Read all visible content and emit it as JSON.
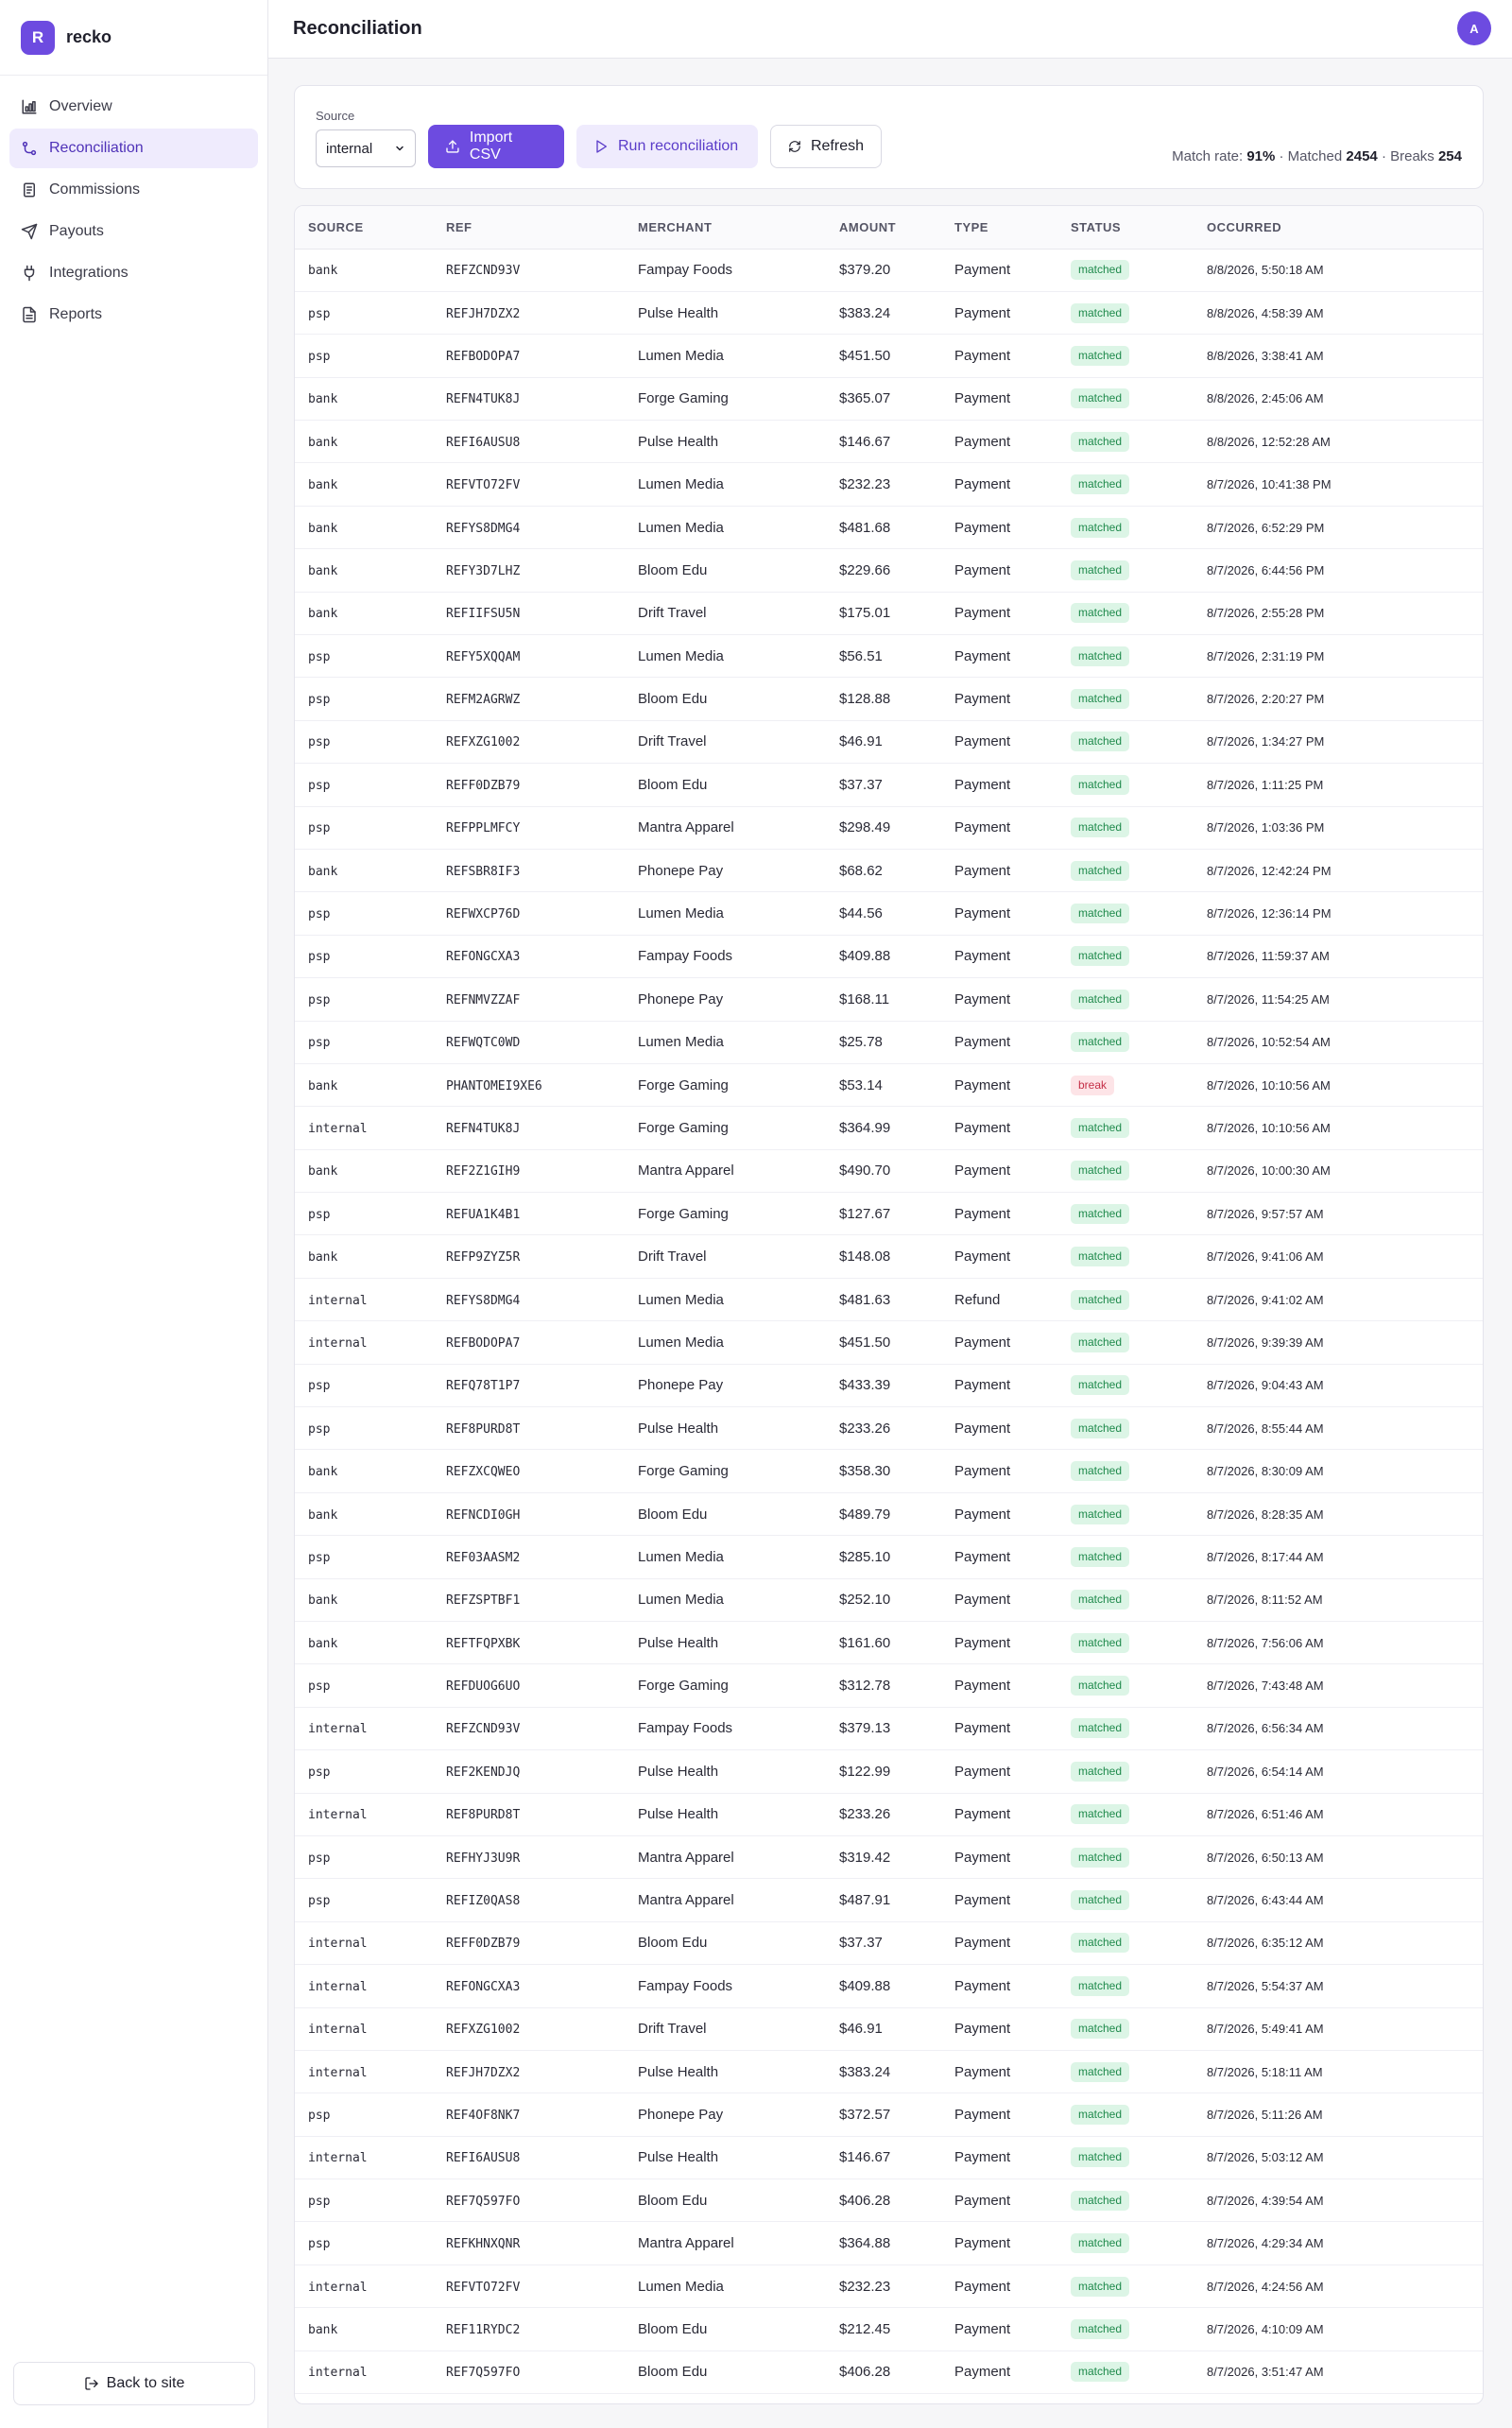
{
  "brand": {
    "logo_letter": "R",
    "name": "recko"
  },
  "nav": [
    {
      "label": "Overview",
      "icon": "bar-chart-icon",
      "active": false
    },
    {
      "label": "Reconciliation",
      "icon": "git-merge-icon",
      "active": true
    },
    {
      "label": "Commissions",
      "icon": "receipt-icon",
      "active": false
    },
    {
      "label": "Payouts",
      "icon": "send-icon",
      "active": false
    },
    {
      "label": "Integrations",
      "icon": "plug-icon",
      "active": false
    },
    {
      "label": "Reports",
      "icon": "file-text-icon",
      "active": false
    }
  ],
  "back_to_site": "Back to site",
  "header": {
    "title": "Reconciliation",
    "avatar": "A"
  },
  "controls": {
    "source_label": "Source",
    "source_value": "internal",
    "import_label": "Import CSV",
    "run_label": "Run reconciliation",
    "refresh_label": "Refresh"
  },
  "stats": {
    "match_rate_label": "Match rate:",
    "match_rate": "91%",
    "matched_label": "· Matched",
    "matched": "2454",
    "breaks_label": "· Breaks",
    "breaks": "254"
  },
  "colors": {
    "accent": "#6d4be0",
    "matched": "#1f8a4c",
    "break": "#c53048"
  },
  "table": {
    "columns": [
      "SOURCE",
      "REF",
      "MERCHANT",
      "AMOUNT",
      "TYPE",
      "STATUS",
      "OCCURRED"
    ],
    "rows": [
      [
        "bank",
        "REFZCND93V",
        "Fampay Foods",
        "$379.20",
        "Payment",
        "matched",
        "8/8/2026, 5:50:18 AM"
      ],
      [
        "psp",
        "REFJH7DZX2",
        "Pulse Health",
        "$383.24",
        "Payment",
        "matched",
        "8/8/2026, 4:58:39 AM"
      ],
      [
        "psp",
        "REFBODOPA7",
        "Lumen Media",
        "$451.50",
        "Payment",
        "matched",
        "8/8/2026, 3:38:41 AM"
      ],
      [
        "bank",
        "REFN4TUK8J",
        "Forge Gaming",
        "$365.07",
        "Payment",
        "matched",
        "8/8/2026, 2:45:06 AM"
      ],
      [
        "bank",
        "REFI6AUSU8",
        "Pulse Health",
        "$146.67",
        "Payment",
        "matched",
        "8/8/2026, 12:52:28 AM"
      ],
      [
        "bank",
        "REFVTO72FV",
        "Lumen Media",
        "$232.23",
        "Payment",
        "matched",
        "8/7/2026, 10:41:38 PM"
      ],
      [
        "bank",
        "REFYS8DMG4",
        "Lumen Media",
        "$481.68",
        "Payment",
        "matched",
        "8/7/2026, 6:52:29 PM"
      ],
      [
        "bank",
        "REFY3D7LHZ",
        "Bloom Edu",
        "$229.66",
        "Payment",
        "matched",
        "8/7/2026, 6:44:56 PM"
      ],
      [
        "bank",
        "REFIIFSU5N",
        "Drift Travel",
        "$175.01",
        "Payment",
        "matched",
        "8/7/2026, 2:55:28 PM"
      ],
      [
        "psp",
        "REFY5XQQAM",
        "Lumen Media",
        "$56.51",
        "Payment",
        "matched",
        "8/7/2026, 2:31:19 PM"
      ],
      [
        "psp",
        "REFM2AGRWZ",
        "Bloom Edu",
        "$128.88",
        "Payment",
        "matched",
        "8/7/2026, 2:20:27 PM"
      ],
      [
        "psp",
        "REFXZG1002",
        "Drift Travel",
        "$46.91",
        "Payment",
        "matched",
        "8/7/2026, 1:34:27 PM"
      ],
      [
        "psp",
        "REFF0DZB79",
        "Bloom Edu",
        "$37.37",
        "Payment",
        "matched",
        "8/7/2026, 1:11:25 PM"
      ],
      [
        "psp",
        "REFPPLMFCY",
        "Mantra Apparel",
        "$298.49",
        "Payment",
        "matched",
        "8/7/2026, 1:03:36 PM"
      ],
      [
        "bank",
        "REFSBR8IF3",
        "Phonepe Pay",
        "$68.62",
        "Payment",
        "matched",
        "8/7/2026, 12:42:24 PM"
      ],
      [
        "psp",
        "REFWXCP76D",
        "Lumen Media",
        "$44.56",
        "Payment",
        "matched",
        "8/7/2026, 12:36:14 PM"
      ],
      [
        "psp",
        "REFONGCXA3",
        "Fampay Foods",
        "$409.88",
        "Payment",
        "matched",
        "8/7/2026, 11:59:37 AM"
      ],
      [
        "psp",
        "REFNMVZZAF",
        "Phonepe Pay",
        "$168.11",
        "Payment",
        "matched",
        "8/7/2026, 11:54:25 AM"
      ],
      [
        "psp",
        "REFWQTC0WD",
        "Lumen Media",
        "$25.78",
        "Payment",
        "matched",
        "8/7/2026, 10:52:54 AM"
      ],
      [
        "bank",
        "PHANTOMEI9XE6",
        "Forge Gaming",
        "$53.14",
        "Payment",
        "break",
        "8/7/2026, 10:10:56 AM"
      ],
      [
        "internal",
        "REFN4TUK8J",
        "Forge Gaming",
        "$364.99",
        "Payment",
        "matched",
        "8/7/2026, 10:10:56 AM"
      ],
      [
        "bank",
        "REF2Z1GIH9",
        "Mantra Apparel",
        "$490.70",
        "Payment",
        "matched",
        "8/7/2026, 10:00:30 AM"
      ],
      [
        "psp",
        "REFUA1K4B1",
        "Forge Gaming",
        "$127.67",
        "Payment",
        "matched",
        "8/7/2026, 9:57:57 AM"
      ],
      [
        "bank",
        "REFP9ZYZ5R",
        "Drift Travel",
        "$148.08",
        "Payment",
        "matched",
        "8/7/2026, 9:41:06 AM"
      ],
      [
        "internal",
        "REFYS8DMG4",
        "Lumen Media",
        "$481.63",
        "Refund",
        "matched",
        "8/7/2026, 9:41:02 AM"
      ],
      [
        "internal",
        "REFBODOPA7",
        "Lumen Media",
        "$451.50",
        "Payment",
        "matched",
        "8/7/2026, 9:39:39 AM"
      ],
      [
        "psp",
        "REFQ78T1P7",
        "Phonepe Pay",
        "$433.39",
        "Payment",
        "matched",
        "8/7/2026, 9:04:43 AM"
      ],
      [
        "psp",
        "REF8PURD8T",
        "Pulse Health",
        "$233.26",
        "Payment",
        "matched",
        "8/7/2026, 8:55:44 AM"
      ],
      [
        "bank",
        "REFZXCQWEO",
        "Forge Gaming",
        "$358.30",
        "Payment",
        "matched",
        "8/7/2026, 8:30:09 AM"
      ],
      [
        "bank",
        "REFNCDI0GH",
        "Bloom Edu",
        "$489.79",
        "Payment",
        "matched",
        "8/7/2026, 8:28:35 AM"
      ],
      [
        "psp",
        "REF03AASM2",
        "Lumen Media",
        "$285.10",
        "Payment",
        "matched",
        "8/7/2026, 8:17:44 AM"
      ],
      [
        "bank",
        "REFZSPTBF1",
        "Lumen Media",
        "$252.10",
        "Payment",
        "matched",
        "8/7/2026, 8:11:52 AM"
      ],
      [
        "bank",
        "REFTFQPXBK",
        "Pulse Health",
        "$161.60",
        "Payment",
        "matched",
        "8/7/2026, 7:56:06 AM"
      ],
      [
        "psp",
        "REFDUOG6UO",
        "Forge Gaming",
        "$312.78",
        "Payment",
        "matched",
        "8/7/2026, 7:43:48 AM"
      ],
      [
        "internal",
        "REFZCND93V",
        "Fampay Foods",
        "$379.13",
        "Payment",
        "matched",
        "8/7/2026, 6:56:34 AM"
      ],
      [
        "psp",
        "REF2KENDJQ",
        "Pulse Health",
        "$122.99",
        "Payment",
        "matched",
        "8/7/2026, 6:54:14 AM"
      ],
      [
        "internal",
        "REF8PURD8T",
        "Pulse Health",
        "$233.26",
        "Payment",
        "matched",
        "8/7/2026, 6:51:46 AM"
      ],
      [
        "psp",
        "REFHYJ3U9R",
        "Mantra Apparel",
        "$319.42",
        "Payment",
        "matched",
        "8/7/2026, 6:50:13 AM"
      ],
      [
        "psp",
        "REFIZ0QAS8",
        "Mantra Apparel",
        "$487.91",
        "Payment",
        "matched",
        "8/7/2026, 6:43:44 AM"
      ],
      [
        "internal",
        "REFF0DZB79",
        "Bloom Edu",
        "$37.37",
        "Payment",
        "matched",
        "8/7/2026, 6:35:12 AM"
      ],
      [
        "internal",
        "REFONGCXA3",
        "Fampay Foods",
        "$409.88",
        "Payment",
        "matched",
        "8/7/2026, 5:54:37 AM"
      ],
      [
        "internal",
        "REFXZG1002",
        "Drift Travel",
        "$46.91",
        "Payment",
        "matched",
        "8/7/2026, 5:49:41 AM"
      ],
      [
        "internal",
        "REFJH7DZX2",
        "Pulse Health",
        "$383.24",
        "Payment",
        "matched",
        "8/7/2026, 5:18:11 AM"
      ],
      [
        "psp",
        "REF4OF8NK7",
        "Phonepe Pay",
        "$372.57",
        "Payment",
        "matched",
        "8/7/2026, 5:11:26 AM"
      ],
      [
        "internal",
        "REFI6AUSU8",
        "Pulse Health",
        "$146.67",
        "Payment",
        "matched",
        "8/7/2026, 5:03:12 AM"
      ],
      [
        "psp",
        "REF7Q597FO",
        "Bloom Edu",
        "$406.28",
        "Payment",
        "matched",
        "8/7/2026, 4:39:54 AM"
      ],
      [
        "psp",
        "REFKHNXQNR",
        "Mantra Apparel",
        "$364.88",
        "Payment",
        "matched",
        "8/7/2026, 4:29:34 AM"
      ],
      [
        "internal",
        "REFVTO72FV",
        "Lumen Media",
        "$232.23",
        "Payment",
        "matched",
        "8/7/2026, 4:24:56 AM"
      ],
      [
        "bank",
        "REF11RYDC2",
        "Bloom Edu",
        "$212.45",
        "Payment",
        "matched",
        "8/7/2026, 4:10:09 AM"
      ],
      [
        "internal",
        "REF7Q597FO",
        "Bloom Edu",
        "$406.28",
        "Payment",
        "matched",
        "8/7/2026, 3:51:47 AM"
      ]
    ]
  }
}
